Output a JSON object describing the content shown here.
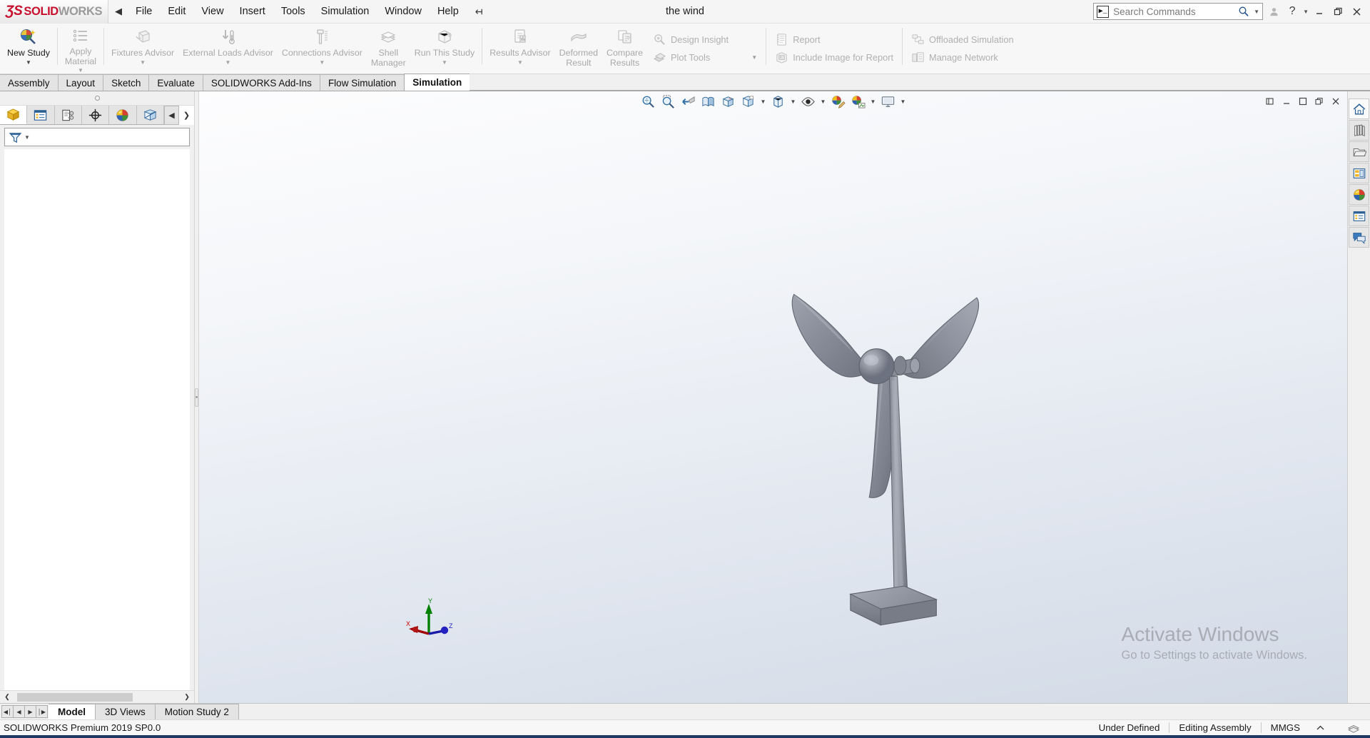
{
  "app": {
    "brand_ds": "ƷS",
    "brand_solid": "SOLID",
    "brand_works": "WORKS",
    "doc_title": "the wind",
    "accent_red": "#c8102e"
  },
  "menubar": {
    "collapse_icon": "left-triangle-icon",
    "items": [
      {
        "label": "File"
      },
      {
        "label": "Edit"
      },
      {
        "label": "View"
      },
      {
        "label": "Insert"
      },
      {
        "label": "Tools"
      },
      {
        "label": "Simulation"
      },
      {
        "label": "Window"
      },
      {
        "label": "Help"
      }
    ],
    "pin_icon": "pushpin-icon"
  },
  "search": {
    "placeholder": "Search Commands",
    "value": "",
    "prompt_glyph": "❯_",
    "magnifier_icon": "search-icon",
    "dropdown_icon": "chevron-down-icon"
  },
  "window_controls": {
    "account_icon": "user-icon",
    "help_icon": "question-mark-icon",
    "help_dropdown_icon": "chevron-down-icon",
    "minimize_icon": "minimize-icon",
    "restore_icon": "restore-icon",
    "close_icon": "close-icon"
  },
  "ribbon": {
    "groups": [
      {
        "type": "large",
        "items": [
          {
            "label": "New Study",
            "icon": "new-study-icon",
            "enabled": true,
            "dropdown": true
          }
        ]
      },
      {
        "type": "large",
        "items": [
          {
            "label": "Apply\nMaterial",
            "icon": "apply-material-icon",
            "enabled": false,
            "dropdown": true
          },
          {
            "label": "Fixtures Advisor",
            "icon": "fixtures-advisor-icon",
            "enabled": false,
            "dropdown": true
          },
          {
            "label": "External Loads Advisor",
            "icon": "external-loads-icon",
            "enabled": false,
            "dropdown": true
          },
          {
            "label": "Connections Advisor",
            "icon": "connections-advisor-icon",
            "enabled": false,
            "dropdown": true
          },
          {
            "label": "Shell\nManager",
            "icon": "shell-manager-icon",
            "enabled": false,
            "dropdown": false
          },
          {
            "label": "Run This Study",
            "icon": "run-study-icon",
            "enabled": false,
            "dropdown": true
          }
        ]
      },
      {
        "type": "large",
        "items": [
          {
            "label": "Results Advisor",
            "icon": "results-advisor-icon",
            "enabled": false,
            "dropdown": true
          },
          {
            "label": "Deformed\nResult",
            "icon": "deformed-result-icon",
            "enabled": false,
            "dropdown": false
          },
          {
            "label": "Compare\nResults",
            "icon": "compare-results-icon",
            "enabled": false,
            "dropdown": false
          }
        ]
      },
      {
        "type": "small",
        "items": [
          {
            "label": "Design Insight",
            "icon": "design-insight-icon",
            "enabled": false
          },
          {
            "label": "Plot Tools",
            "icon": "plot-tools-icon",
            "enabled": false,
            "dropdown": true
          }
        ]
      },
      {
        "type": "small",
        "items": [
          {
            "label": "Report",
            "icon": "report-icon",
            "enabled": false
          },
          {
            "label": "Include Image for Report",
            "icon": "include-image-icon",
            "enabled": false
          }
        ]
      },
      {
        "type": "small",
        "items": [
          {
            "label": "Offloaded Simulation",
            "icon": "offloaded-simulation-icon",
            "enabled": false
          },
          {
            "label": "Manage Network",
            "icon": "manage-network-icon",
            "enabled": false
          }
        ]
      }
    ]
  },
  "command_tabs": {
    "active": "Simulation",
    "items": [
      {
        "label": "Assembly"
      },
      {
        "label": "Layout"
      },
      {
        "label": "Sketch"
      },
      {
        "label": "Evaluate"
      },
      {
        "label": "SOLIDWORKS Add-Ins"
      },
      {
        "label": "Flow Simulation"
      },
      {
        "label": "Simulation"
      }
    ]
  },
  "feature_manager": {
    "tabs": [
      {
        "name": "feature-manager-design-tree-tab",
        "icon": "yellow-cube-icon",
        "active": true
      },
      {
        "name": "property-manager-tab",
        "icon": "property-list-icon",
        "active": false
      },
      {
        "name": "configuration-manager-tab",
        "icon": "configuration-icon",
        "active": false
      },
      {
        "name": "dimxpert-manager-tab",
        "icon": "crosshair-target-icon",
        "active": false
      },
      {
        "name": "display-manager-tab",
        "icon": "color-sphere-icon",
        "active": false
      },
      {
        "name": "simulation-study-tab",
        "icon": "simulation-study-icon",
        "active": false
      }
    ],
    "nav_prev_icon": "left-triangle-icon",
    "nav_next_icon": "right-chevron-icon",
    "filter_icon": "filter-funnel-icon",
    "filter_dropdown_icon": "chevron-down-icon",
    "filter_value": "",
    "scroll_left_icon": "left-chevron-icon",
    "scroll_right_icon": "right-chevron-icon"
  },
  "heads_up_toolbar": {
    "buttons": [
      {
        "name": "zoom-to-fit-icon",
        "dropdown": false
      },
      {
        "name": "zoom-to-area-icon",
        "dropdown": false
      },
      {
        "name": "previous-view-icon",
        "dropdown": false
      },
      {
        "name": "section-view-icon",
        "dropdown": false
      },
      {
        "name": "view-orientation-icon",
        "dropdown": false
      },
      {
        "name": "view-orientation-cube-icon",
        "dropdown": true
      },
      {
        "name": "display-style-icon",
        "dropdown": true
      },
      {
        "name": "hide-show-items-icon",
        "dropdown": true
      },
      {
        "name": "edit-appearance-icon",
        "dropdown": false
      },
      {
        "name": "apply-scene-icon",
        "dropdown": true
      },
      {
        "name": "view-settings-icon",
        "dropdown": true
      }
    ]
  },
  "graphics_window_controls": {
    "restore_small_icon": "restore-pane-icon",
    "minimize_icon": "minimize-icon",
    "maximize_icon": "maximize-icon",
    "restore_icon": "restore-icon",
    "close_icon": "close-icon"
  },
  "triad": {
    "x_label": "X",
    "y_label": "Y",
    "z_label": "Z",
    "x_color": "#c00000",
    "y_color": "#008000",
    "z_color": "#0000c0"
  },
  "task_pane": {
    "buttons": [
      {
        "name": "solidworks-resources-icon",
        "active": true
      },
      {
        "name": "design-library-icon",
        "active": false
      },
      {
        "name": "file-explorer-icon",
        "active": false
      },
      {
        "name": "view-palette-icon",
        "active": false
      },
      {
        "name": "appearances-scenes-icon",
        "active": false
      },
      {
        "name": "custom-properties-icon",
        "active": false
      },
      {
        "name": "solidworks-forum-icon",
        "active": false
      }
    ]
  },
  "watermark": {
    "line1": "Activate Windows",
    "line2": "Go to Settings to activate Windows."
  },
  "bottom_tabs": {
    "nav": [
      {
        "name": "first-tab-button",
        "glyph": "◀│"
      },
      {
        "name": "previous-tab-button",
        "glyph": "◀"
      },
      {
        "name": "next-tab-button",
        "glyph": "▶"
      },
      {
        "name": "last-tab-button",
        "glyph": "│▶"
      }
    ],
    "active": "Model",
    "items": [
      {
        "label": "Model"
      },
      {
        "label": "3D Views"
      },
      {
        "label": "Motion Study 2"
      }
    ]
  },
  "status_bar": {
    "version": "SOLIDWORKS Premium 2019 SP0.0",
    "state": "Under Defined",
    "context": "Editing Assembly",
    "units": "MMGS",
    "units_dropdown_icon": "chevron-up-icon",
    "overlay_icon": "stacked-sheets-icon"
  }
}
